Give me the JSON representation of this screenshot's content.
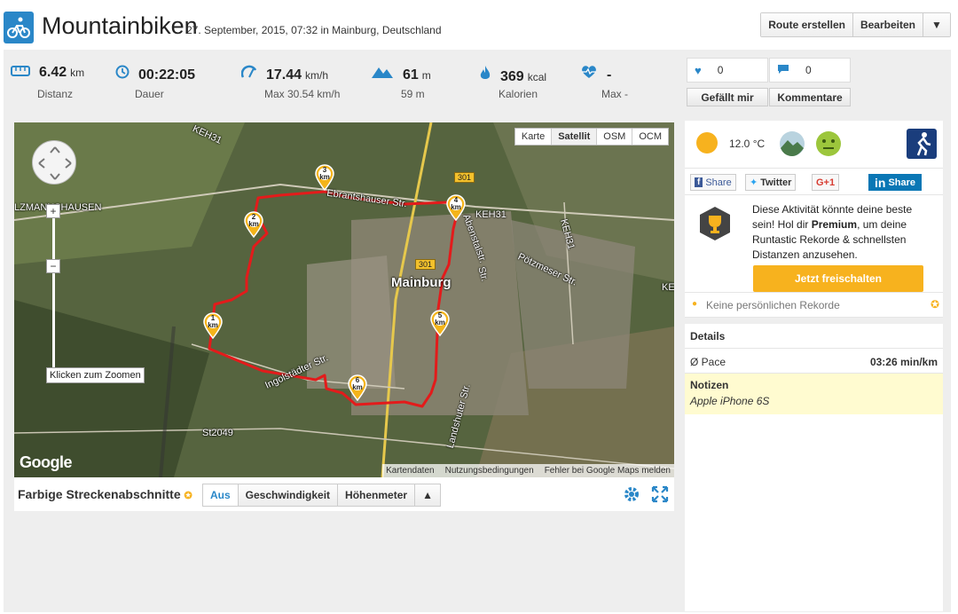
{
  "header": {
    "title": "Mountainbiken",
    "subtitle": "27. September, 2015, 07:32 in Mainburg, Deutschland",
    "buttons": {
      "create_route": "Route erstellen",
      "edit": "Bearbeiten",
      "more": "▼"
    }
  },
  "stats": [
    {
      "icon": "ruler-icon",
      "value": "6.42",
      "unit": "km",
      "label": "Distanz"
    },
    {
      "icon": "clock-icon",
      "value": "00:22:05",
      "unit": "",
      "label": "Dauer"
    },
    {
      "icon": "speedometer-icon",
      "value": "17.44",
      "unit": "km/h",
      "label": "Max 30.54 km/h"
    },
    {
      "icon": "mountain-icon",
      "value": "61",
      "unit": "m",
      "label": "59 m"
    },
    {
      "icon": "flame-icon",
      "value": "369",
      "unit": "kcal",
      "label": "Kalorien"
    },
    {
      "icon": "heartrate-icon",
      "value": "-",
      "unit": "",
      "label": "Max -"
    }
  ],
  "social": {
    "likes_count": "0",
    "comments_count": "0",
    "like_label": "Gefällt mir",
    "comment_label": "Kommentare"
  },
  "map": {
    "tabs": [
      "Karte",
      "Satellit",
      "OSM",
      "OCM"
    ],
    "active_tab": "Satellit",
    "zoom_tooltip": "Klicken zum Zoomen",
    "zoom_in": "+",
    "zoom_out": "−",
    "google_logo": "Google",
    "attribution": [
      "Kartendaten",
      "Nutzungsbedingungen",
      "Fehler bei Google Maps melden"
    ],
    "place_labels": {
      "town": "Mainburg",
      "village": "LZMANNSHAUSEN",
      "road1": "Ebrantshauser Str.",
      "road2": "Ingolstädter Str.",
      "road3": "Pötzmeser Str.",
      "road4": "Landshuter Str.",
      "road5": "KEH31",
      "road6": "KEH31",
      "road7": "KEH31",
      "road8": "St2049",
      "road9": "KE",
      "road10": "Abenstalstr.",
      "road11": "Str."
    },
    "road_signs": [
      "301",
      "301"
    ],
    "markers": [
      "1",
      "2",
      "3",
      "4",
      "5",
      "6"
    ],
    "marker_unit": "km"
  },
  "map_bar": {
    "label": "Farbige Streckenabschnitte",
    "buttons": [
      "Aus",
      "Geschwindigkeit",
      "Höhenmeter",
      "▲"
    ],
    "active": "Aus"
  },
  "right_panel": {
    "temperature": "12.0 °C",
    "share": {
      "facebook": "Share",
      "twitter": "Twitter",
      "gplus": "G+1",
      "linkedin": "Share"
    },
    "promo_text_1": "Diese Aktivität könnte deine beste sein! Hol dir ",
    "promo_text_bold": "Premium",
    "promo_text_2": ", um deine Runtastic Rekorde & schnellsten Distanzen anzusehen.",
    "unlock_button": "Jetzt freischalten",
    "records": "Keine persönlichen Rekorde",
    "details_title": "Details",
    "pace_label": "Ø Pace",
    "pace_value": "03:26 min/km",
    "notes_title": "Notizen",
    "notes_value": "Apple iPhone 6S"
  },
  "colors": {
    "accent": "#2a87c8",
    "route": "#e31b1b",
    "marker": "#f4b41a",
    "premium": "#f7b21e"
  }
}
